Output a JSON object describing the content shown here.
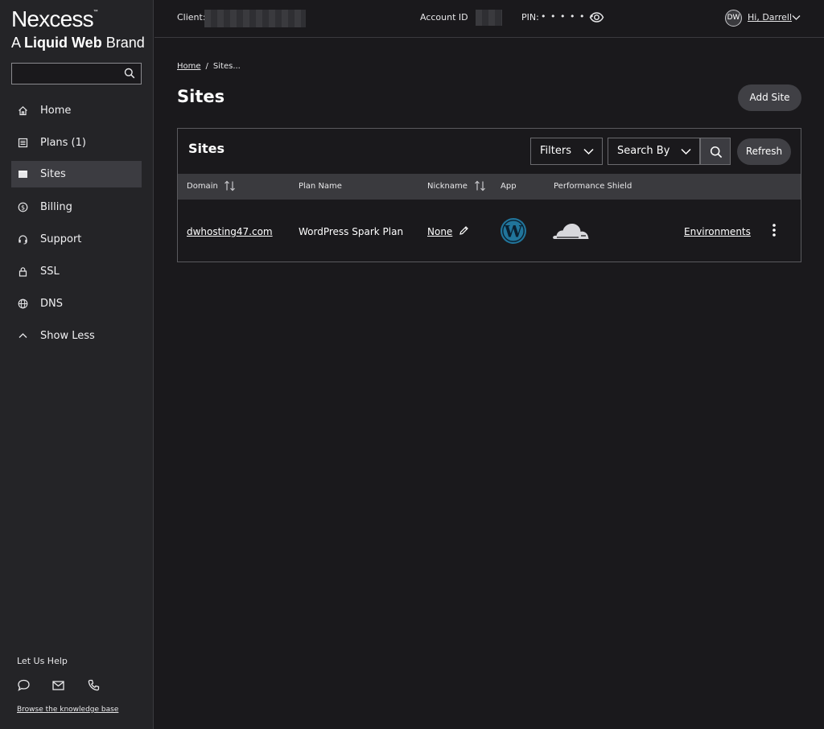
{
  "brand": {
    "name": "Nexcess",
    "trademark": "™",
    "tagline_prefix": "A",
    "tagline_bold": "Liquid Web",
    "tagline_suffix": "Brand"
  },
  "sidebar": {
    "search": {
      "placeholder": "",
      "icon": "search-icon"
    },
    "items": [
      {
        "label": "Home",
        "icon": "home-icon",
        "active": false
      },
      {
        "label": "Plans (1)",
        "icon": "plans-icon",
        "active": false
      },
      {
        "label": "Sites",
        "icon": "sites-icon",
        "active": true
      },
      {
        "label": "Billing",
        "icon": "billing-icon",
        "active": false
      },
      {
        "label": "Support",
        "icon": "support-icon",
        "active": false
      },
      {
        "label": "SSL",
        "icon": "lock-icon",
        "active": false
      },
      {
        "label": "DNS",
        "icon": "globe-icon",
        "active": false
      },
      {
        "label": "Show Less",
        "icon": "chevron-up-icon",
        "active": false
      }
    ],
    "help": {
      "title": "Let Us Help",
      "icons": [
        "chat-icon",
        "mail-icon",
        "phone-icon"
      ],
      "kb_link": "Browse the knowledge base"
    }
  },
  "topbar": {
    "client_label": "Client:",
    "account_label": "Account ID",
    "pin_label": "PIN:",
    "pin_mask": "• • • • • •",
    "avatar_initials": "DW",
    "greeting": "Hi, Darrell"
  },
  "main": {
    "breadcrumb": {
      "home": "Home",
      "separator": "/",
      "current": "Sites..."
    },
    "title": "Sites",
    "add_site_label": "Add Site",
    "panel": {
      "title": "Sites",
      "filters_label": "Filters",
      "search_by_label": "Search By",
      "refresh_label": "Refresh",
      "columns": {
        "domain": "Domain",
        "plan_name": "Plan Name",
        "nickname": "Nickname",
        "app": "App",
        "performance_shield": "Performance Shield"
      },
      "rows": [
        {
          "domain": "dwhosting47.com",
          "plan_name": "WordPress Spark Plan",
          "nickname": "None",
          "app_icon": "wordpress-icon",
          "shield_icon": "cloudflare-icon",
          "environments_label": "Environments"
        }
      ]
    }
  },
  "colors": {
    "background": "#1a191c",
    "sidebar": "#242427",
    "active_item": "#3c3c41",
    "table_header": "#3a3a3e",
    "wordpress_blue": "#21759b",
    "text": "#e8e8ea"
  }
}
